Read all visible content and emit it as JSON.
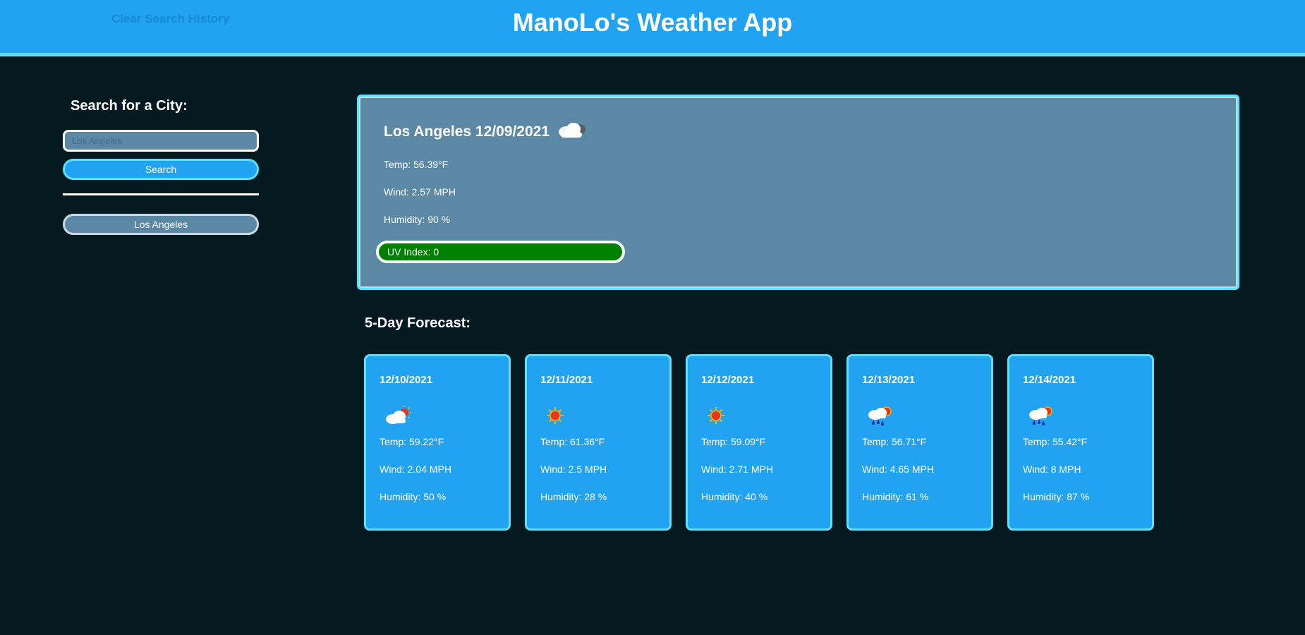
{
  "header": {
    "clear_history_label": "Clear Search History",
    "title": "ManoLo's Weather App"
  },
  "sidebar": {
    "heading": "Search for a City:",
    "search_placeholder": "Los Angeles",
    "search_button_label": "Search",
    "history": [
      "Los Angeles"
    ]
  },
  "current": {
    "title": "Los Angeles 12/09/2021",
    "icon": "cloud-icon",
    "temp": "Temp: 56.39°F",
    "wind": "Wind: 2.57 MPH",
    "humidity": "Humidity: 90 %",
    "uv": "UV Index: 0",
    "uv_color": "#008000"
  },
  "forecast": {
    "heading": "5-Day Forecast:",
    "days": [
      {
        "date": "12/10/2021",
        "icon": "partly-cloudy-icon",
        "temp": "Temp: 59.22°F",
        "wind": "Wind: 2.04 MPH",
        "humidity": "Humidity: 50 %"
      },
      {
        "date": "12/11/2021",
        "icon": "sun-icon",
        "temp": "Temp: 61.36°F",
        "wind": "Wind: 2.5 MPH",
        "humidity": "Humidity: 28 %"
      },
      {
        "date": "12/12/2021",
        "icon": "sun-icon",
        "temp": "Temp: 59.09°F",
        "wind": "Wind: 2.71 MPH",
        "humidity": "Humidity: 40 %"
      },
      {
        "date": "12/13/2021",
        "icon": "rain-sun-icon",
        "temp": "Temp: 56.71°F",
        "wind": "Wind: 4.65 MPH",
        "humidity": "Humidity: 61 %"
      },
      {
        "date": "12/14/2021",
        "icon": "rain-sun-icon",
        "temp": "Temp: 55.42°F",
        "wind": "Wind: 8 MPH",
        "humidity": "Humidity: 87 %"
      }
    ]
  },
  "colors": {
    "background": "#041a20",
    "header": "#22a3f2",
    "accent_border": "#5de0fb",
    "card_current": "#5b89a5",
    "card_forecast": "#22a3f2"
  }
}
